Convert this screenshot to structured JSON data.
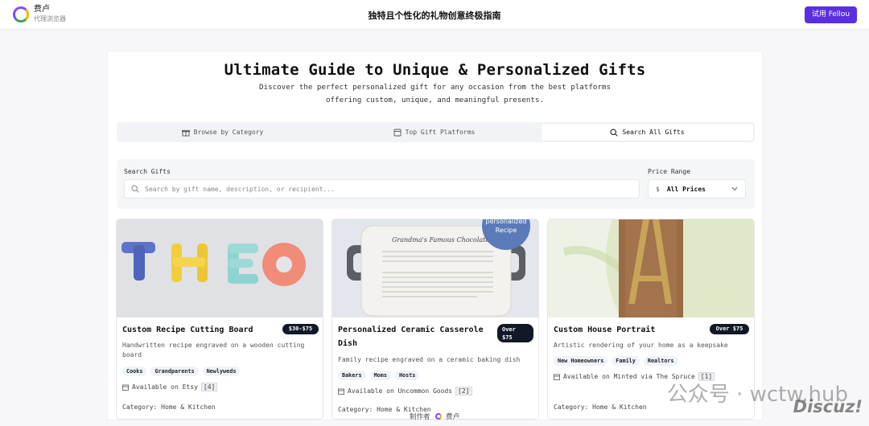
{
  "app": {
    "name": "费卢",
    "subtitle": "代理浏览器",
    "page_title": "独特且个性化的礼物创意终极指南",
    "try_button": "试用 Fellou"
  },
  "hero": {
    "title": "Ultimate Guide to Unique & Personalized Gifts",
    "subtitle_line1": "Discover the perfect personalized gift for any occasion from the best platforms",
    "subtitle_line2": "offering custom, unique, and meaningful presents."
  },
  "tabs": [
    {
      "label": "Browse by Category",
      "icon": "gift-icon",
      "active": false
    },
    {
      "label": "Top Gift Platforms",
      "icon": "store-icon",
      "active": false
    },
    {
      "label": "Search All Gifts",
      "icon": "search-icon",
      "active": true
    }
  ],
  "search": {
    "label": "Search Gifts",
    "placeholder": "Search by gift name, description, or recipient...",
    "price_label": "Price Range",
    "price_currency": "$",
    "price_value": "All Prices"
  },
  "cards": [
    {
      "title": "Custom Recipe Cutting Board",
      "price": "$30-$75",
      "description": "Handwritten recipe engraved on a wooden cutting board",
      "tags": [
        "Cooks",
        "Grandparents",
        "Newlyweds"
      ],
      "available": "Available on Etsy",
      "count": "[4]",
      "category": "Category: Home & Kitchen"
    },
    {
      "title": "Personalized Ceramic Casserole Dish",
      "price_line1": "Over",
      "price_line2": "$75",
      "description": "Family recipe engraved on a ceramic baking dish",
      "tags": [
        "Bakers",
        "Moms",
        "Hosts"
      ],
      "available": "Available on Uncommon Goods",
      "count": "[2]",
      "category": "Category: Home & Kitchen",
      "image_text_1": "personalized",
      "image_text_2": "Recipe",
      "image_heading": "Grandma's Famous Chocolate Cake"
    },
    {
      "title": "Custom House Portrait",
      "price": "Over $75",
      "description": "Artistic rendering of your home as a keepsake",
      "tags": [
        "New Homeowners",
        "Family",
        "Realtors"
      ],
      "available": "Available on Minted via The Spruce",
      "count": "[1]",
      "category": "Category: Home & Kitchen"
    }
  ],
  "footer": {
    "made_by": "制作者",
    "brand": "费卢"
  },
  "watermark": {
    "line1": "公众号 · wctw.hub",
    "line2": "Discuz!"
  },
  "colors": {
    "accent": "#5b2ee6",
    "price_badge": "#111827",
    "tag_bg": "#eef3fb"
  }
}
